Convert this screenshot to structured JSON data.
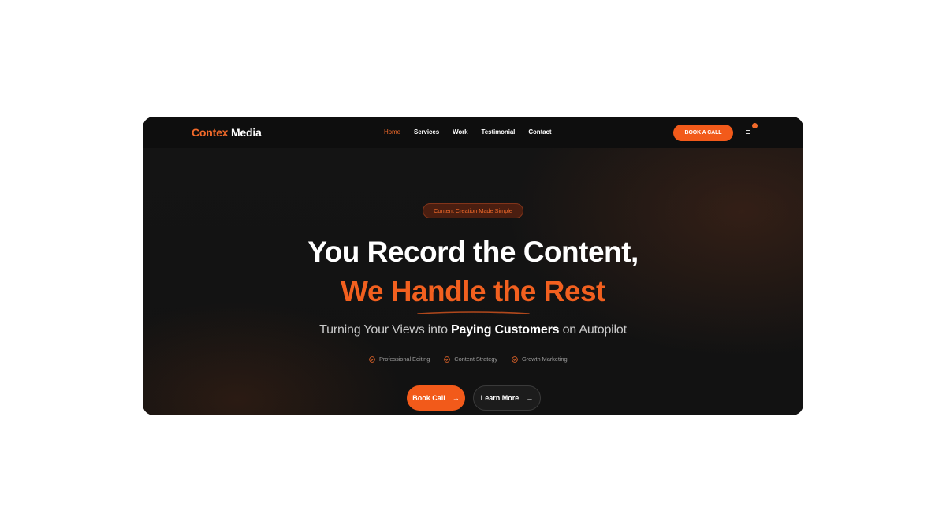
{
  "nav": {
    "logo_brand": "Contex",
    "logo_media": "Media",
    "links": [
      {
        "label": "Home",
        "active": true
      },
      {
        "label": "Services",
        "active": false
      },
      {
        "label": "Work",
        "active": false
      },
      {
        "label": "Testimonial",
        "active": false
      },
      {
        "label": "Contact",
        "active": false
      }
    ],
    "book_button": "BOOK A CALL",
    "menu_icon": "hamburger-icon"
  },
  "hero": {
    "badge": "Content Creation Made Simple",
    "headline_line1": "You Record the Content,",
    "headline_line2": "We Handle the Rest",
    "subheadline_pre": "Turning Your Views into ",
    "subheadline_bold": "Paying Customers",
    "subheadline_post": " on Autopilot",
    "features": [
      "Professional Editing",
      "Content Strategy",
      "Growth Marketing"
    ],
    "cta_primary": "Book Call",
    "cta_secondary": "Learn More",
    "cta_arrow": "→"
  },
  "colors": {
    "accent": "#f26a2a",
    "background": "#121212",
    "text": "#ffffff"
  }
}
